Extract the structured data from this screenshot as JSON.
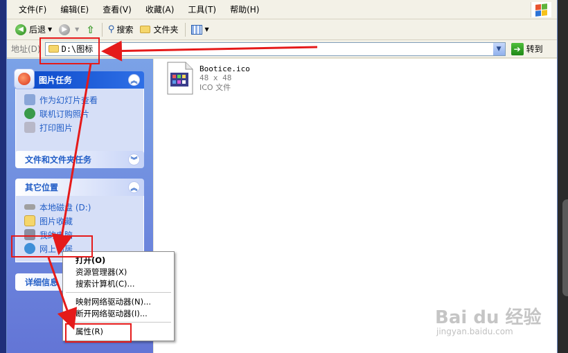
{
  "menubar": {
    "items": [
      "文件(F)",
      "编辑(E)",
      "查看(V)",
      "收藏(A)",
      "工具(T)",
      "帮助(H)"
    ]
  },
  "toolbar": {
    "back_label": "后退",
    "search_label": "搜索",
    "folders_label": "文件夹"
  },
  "address": {
    "label": "地址(D)",
    "path": "D:\\图标",
    "go_label": "转到"
  },
  "left_pane": {
    "picture_tasks": {
      "title": "图片任务",
      "items": [
        "作为幻灯片查看",
        "联机订购照片",
        "打印图片"
      ]
    },
    "file_tasks": {
      "title": "文件和文件夹任务"
    },
    "other_places": {
      "title": "其它位置",
      "items": [
        "本地磁盘 (D:)",
        "图片收藏",
        "我的电脑",
        "网上邻居"
      ]
    },
    "details": {
      "title": "详细信息"
    }
  },
  "file": {
    "name": "Bootice.ico",
    "dimensions": "48 x 48",
    "type": "ICO 文件"
  },
  "context_menu": {
    "items": [
      "打开(O)",
      "资源管理器(X)",
      "搜索计算机(C)...",
      "映射网络驱动器(N)...",
      "断开网络驱动器(I)...",
      "属性(R)"
    ]
  },
  "watermark": {
    "main": "Bai du 经验",
    "sub": "jingyan.baidu.com"
  },
  "colors": {
    "accent": "#215dc6",
    "annotation_red": "#e51a1a"
  }
}
